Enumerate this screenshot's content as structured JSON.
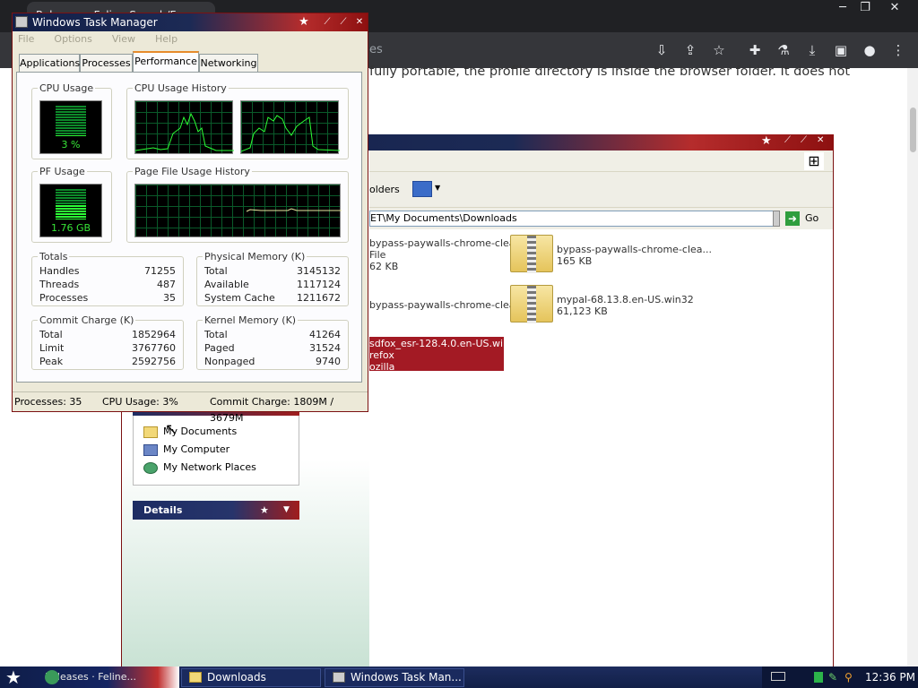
{
  "browser": {
    "tab_title": "Releases · Feline-Search/Fox...",
    "omnibox_text": "es",
    "window_buttons": [
      "─",
      "❐",
      "✕"
    ],
    "toolbar_icons": [
      "install-icon",
      "share-icon",
      "star-icon",
      "extensions-icon",
      "lab-icon",
      "download-icon",
      "sidepanel-icon",
      "profile-icon",
      "menu-icon"
    ],
    "page_text": "fully portable, the profile directory is inside the browser folder. It does not"
  },
  "explorer": {
    "toolbar_folders_label": "olders",
    "address": "ET\\My Documents\\Downloads",
    "go_label": "Go",
    "files": [
      {
        "name": "bypass-paywalls-chrome-clea...",
        "line2": "File",
        "line3": "62 KB"
      },
      {
        "name": "bypass-paywalls-chrome-clea...",
        "line2": "165 KB",
        "line3": ""
      },
      {
        "name": "bypass-paywalls-chrome-clea...",
        "line2": "",
        "line3": ""
      },
      {
        "name": "mypal-68.13.8.en-US.win32",
        "line2": "61,123 KB",
        "line3": ""
      },
      {
        "name": "sdfox_esr-128.4.0.en-US.wi...",
        "line2": "refox",
        "line3": "ozilla"
      }
    ],
    "other_places": [
      {
        "label": "My Documents",
        "icon": "folder-icon"
      },
      {
        "label": "My Computer",
        "icon": "computer-icon"
      },
      {
        "label": "My Network Places",
        "icon": "network-icon"
      }
    ],
    "details_label": "Details"
  },
  "taskmanager": {
    "title": "Windows Task Manager",
    "menu": [
      "File",
      "Options",
      "View",
      "Help"
    ],
    "tabs": [
      "Applications",
      "Processes",
      "Performance",
      "Networking"
    ],
    "active_tab": "Performance",
    "cpu_usage_label": "CPU Usage",
    "cpu_usage_value": "3 %",
    "cpu_usage_fraction": 0.03,
    "cpu_history_label": "CPU Usage History",
    "pf_usage_label": "PF Usage",
    "pf_usage_value": "1.76 GB",
    "pf_usage_fraction": 0.48,
    "pf_history_label": "Page File Usage History",
    "totals": {
      "label": "Totals",
      "rows": [
        [
          "Handles",
          "71255"
        ],
        [
          "Threads",
          "487"
        ],
        [
          "Processes",
          "35"
        ]
      ]
    },
    "physical": {
      "label": "Physical Memory (K)",
      "rows": [
        [
          "Total",
          "3145132"
        ],
        [
          "Available",
          "1117124"
        ],
        [
          "System Cache",
          "1211672"
        ]
      ]
    },
    "commit": {
      "label": "Commit Charge (K)",
      "rows": [
        [
          "Total",
          "1852964"
        ],
        [
          "Limit",
          "3767760"
        ],
        [
          "Peak",
          "2592756"
        ]
      ]
    },
    "kernel": {
      "label": "Kernel Memory (K)",
      "rows": [
        [
          "Total",
          "41264"
        ],
        [
          "Paged",
          "31524"
        ],
        [
          "Nonpaged",
          "9740"
        ]
      ]
    },
    "status": {
      "processes": "Processes: 35",
      "cpu": "CPU Usage: 3%",
      "commit": "Commit Charge: 1809M / 3679M"
    }
  },
  "taskbar": {
    "start_task": "Releases · Feline...",
    "tasks": [
      "Downloads",
      "Windows Task Man..."
    ],
    "clock": "12:36 PM"
  },
  "colors": {
    "title_navy": "#13204a",
    "title_red": "#b52c2c",
    "selection": "#a31a24",
    "graph_green": "#2cff36"
  }
}
